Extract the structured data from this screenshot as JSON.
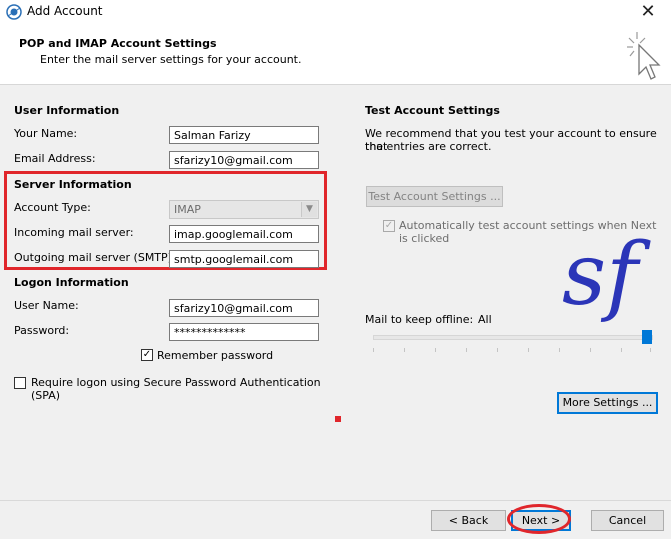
{
  "window": {
    "title": "Add Account",
    "close_glyph": "✕"
  },
  "header": {
    "title": "POP and IMAP Account Settings",
    "subtitle": "Enter the mail server settings for your account."
  },
  "user_info": {
    "section_title": "User Information",
    "name_label": "Your Name:",
    "name_value": "Salman Farizy",
    "email_label": "Email Address:",
    "email_value": "sfarizy10@gmail.com"
  },
  "server_info": {
    "section_title": "Server Information",
    "account_type_label": "Account Type:",
    "account_type_value": "IMAP",
    "incoming_label": "Incoming mail server:",
    "incoming_value": "imap.googlemail.com",
    "outgoing_label": "Outgoing mail server (SMTP):",
    "outgoing_value": "smtp.googlemail.com"
  },
  "logon_info": {
    "section_title": "Logon Information",
    "username_label": "User Name:",
    "username_value": "sfarizy10@gmail.com",
    "password_label": "Password:",
    "password_value": "*************",
    "remember_label": "Remember password",
    "remember_checked": true,
    "spa_label_line1": "Require logon using Secure Password Authentication",
    "spa_label_line2": "(SPA)",
    "spa_checked": false
  },
  "test_settings": {
    "section_title": "Test Account Settings",
    "description_line1": "We recommend that you test your account to ensure that",
    "description_line2": "the entries are correct.",
    "test_button_label": "Test Account Settings ...",
    "auto_test_line1": "Automatically test account settings when Next",
    "auto_test_line2": "is clicked",
    "auto_test_checked": true
  },
  "offline": {
    "label": "Mail to keep offline:",
    "value": "All",
    "slider_fraction": 1.0
  },
  "watermark": {
    "text": "sf",
    "color": "#2b35b8"
  },
  "buttons": {
    "more_settings": "More Settings ...",
    "back": "< Back",
    "next": "Next >",
    "cancel": "Cancel"
  },
  "colors": {
    "highlight_red": "#e0262b",
    "accent_blue": "#0078d7"
  },
  "icons": {
    "app": "outlook-icon",
    "header_art": "cursor-click-icon"
  }
}
